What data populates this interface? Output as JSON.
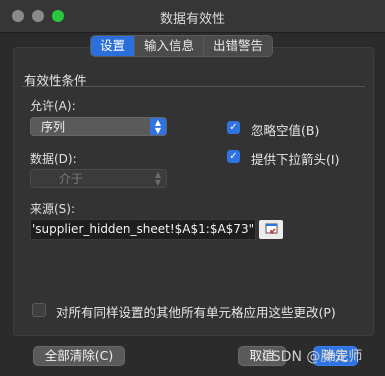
{
  "window": {
    "title": "数据有效性"
  },
  "tabs": [
    {
      "label": "设置"
    },
    {
      "label": "输入信息"
    },
    {
      "label": "出错警告"
    }
  ],
  "validation": {
    "section_title": "有效性条件",
    "allow_label": "允许(A):",
    "allow_value": "序列",
    "data_label": "数据(D):",
    "data_value": "介于",
    "ignore_blank_label": "忽略空值(B)",
    "ignore_blank_checked": true,
    "dropdown_label": "提供下拉箭头(I)",
    "dropdown_checked": true,
    "source_label": "来源(S):",
    "source_value": "'supplier_hidden_sheet!$A$1:$A$73\")"
  },
  "apply_all": {
    "label": "对所有同样设置的其他所有单元格应用这些更改(P)",
    "checked": false
  },
  "buttons": {
    "clear_all": "全部清除(C)",
    "cancel": "取消",
    "ok": "确定"
  },
  "watermark": "CSDN @胖先师",
  "colors": {
    "accent": "#2f73e0",
    "background": "#2b2b2b"
  },
  "icons": {
    "collapse": "collapse-dialog-icon",
    "select_arrows": "updown-chevron-icon",
    "check": "checkmark-icon"
  }
}
